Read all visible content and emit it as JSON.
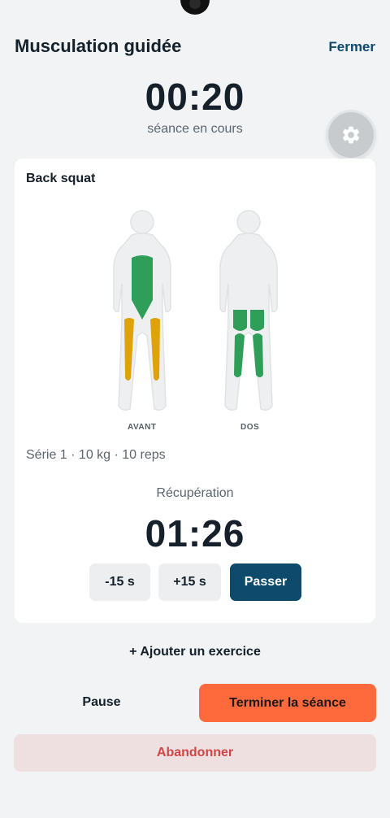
{
  "header": {
    "title": "Musculation guidée",
    "close_label": "Fermer"
  },
  "session": {
    "timer": "00:20",
    "status": "séance en cours"
  },
  "settings": {
    "icon": "gear-icon"
  },
  "exercise": {
    "name": "Back squat",
    "views": {
      "front": "AVANT",
      "back": "DOS"
    },
    "muscles_front": [
      "abdominaux",
      "quadriceps"
    ],
    "muscles_back": [
      "ischio-jambiers"
    ],
    "set_info": "Série 1 · 10 kg · 10 reps",
    "rest": {
      "label": "Récupération",
      "timer": "01:26"
    },
    "buttons": {
      "minus": "-15 s",
      "plus": "+15 s",
      "skip": "Passer"
    }
  },
  "actions": {
    "add_exercise": "+ Ajouter un exercice",
    "pause": "Pause",
    "finish": "Terminer la séance",
    "abandon": "Abandonner"
  },
  "colors": {
    "accent": "#0d4a6b",
    "finish": "#ff6a3d",
    "abandon_bg": "#eedfe0",
    "abandon_text": "#d14545",
    "muscle_green": "#2e9e58",
    "muscle_yellow": "#e0a20a"
  }
}
